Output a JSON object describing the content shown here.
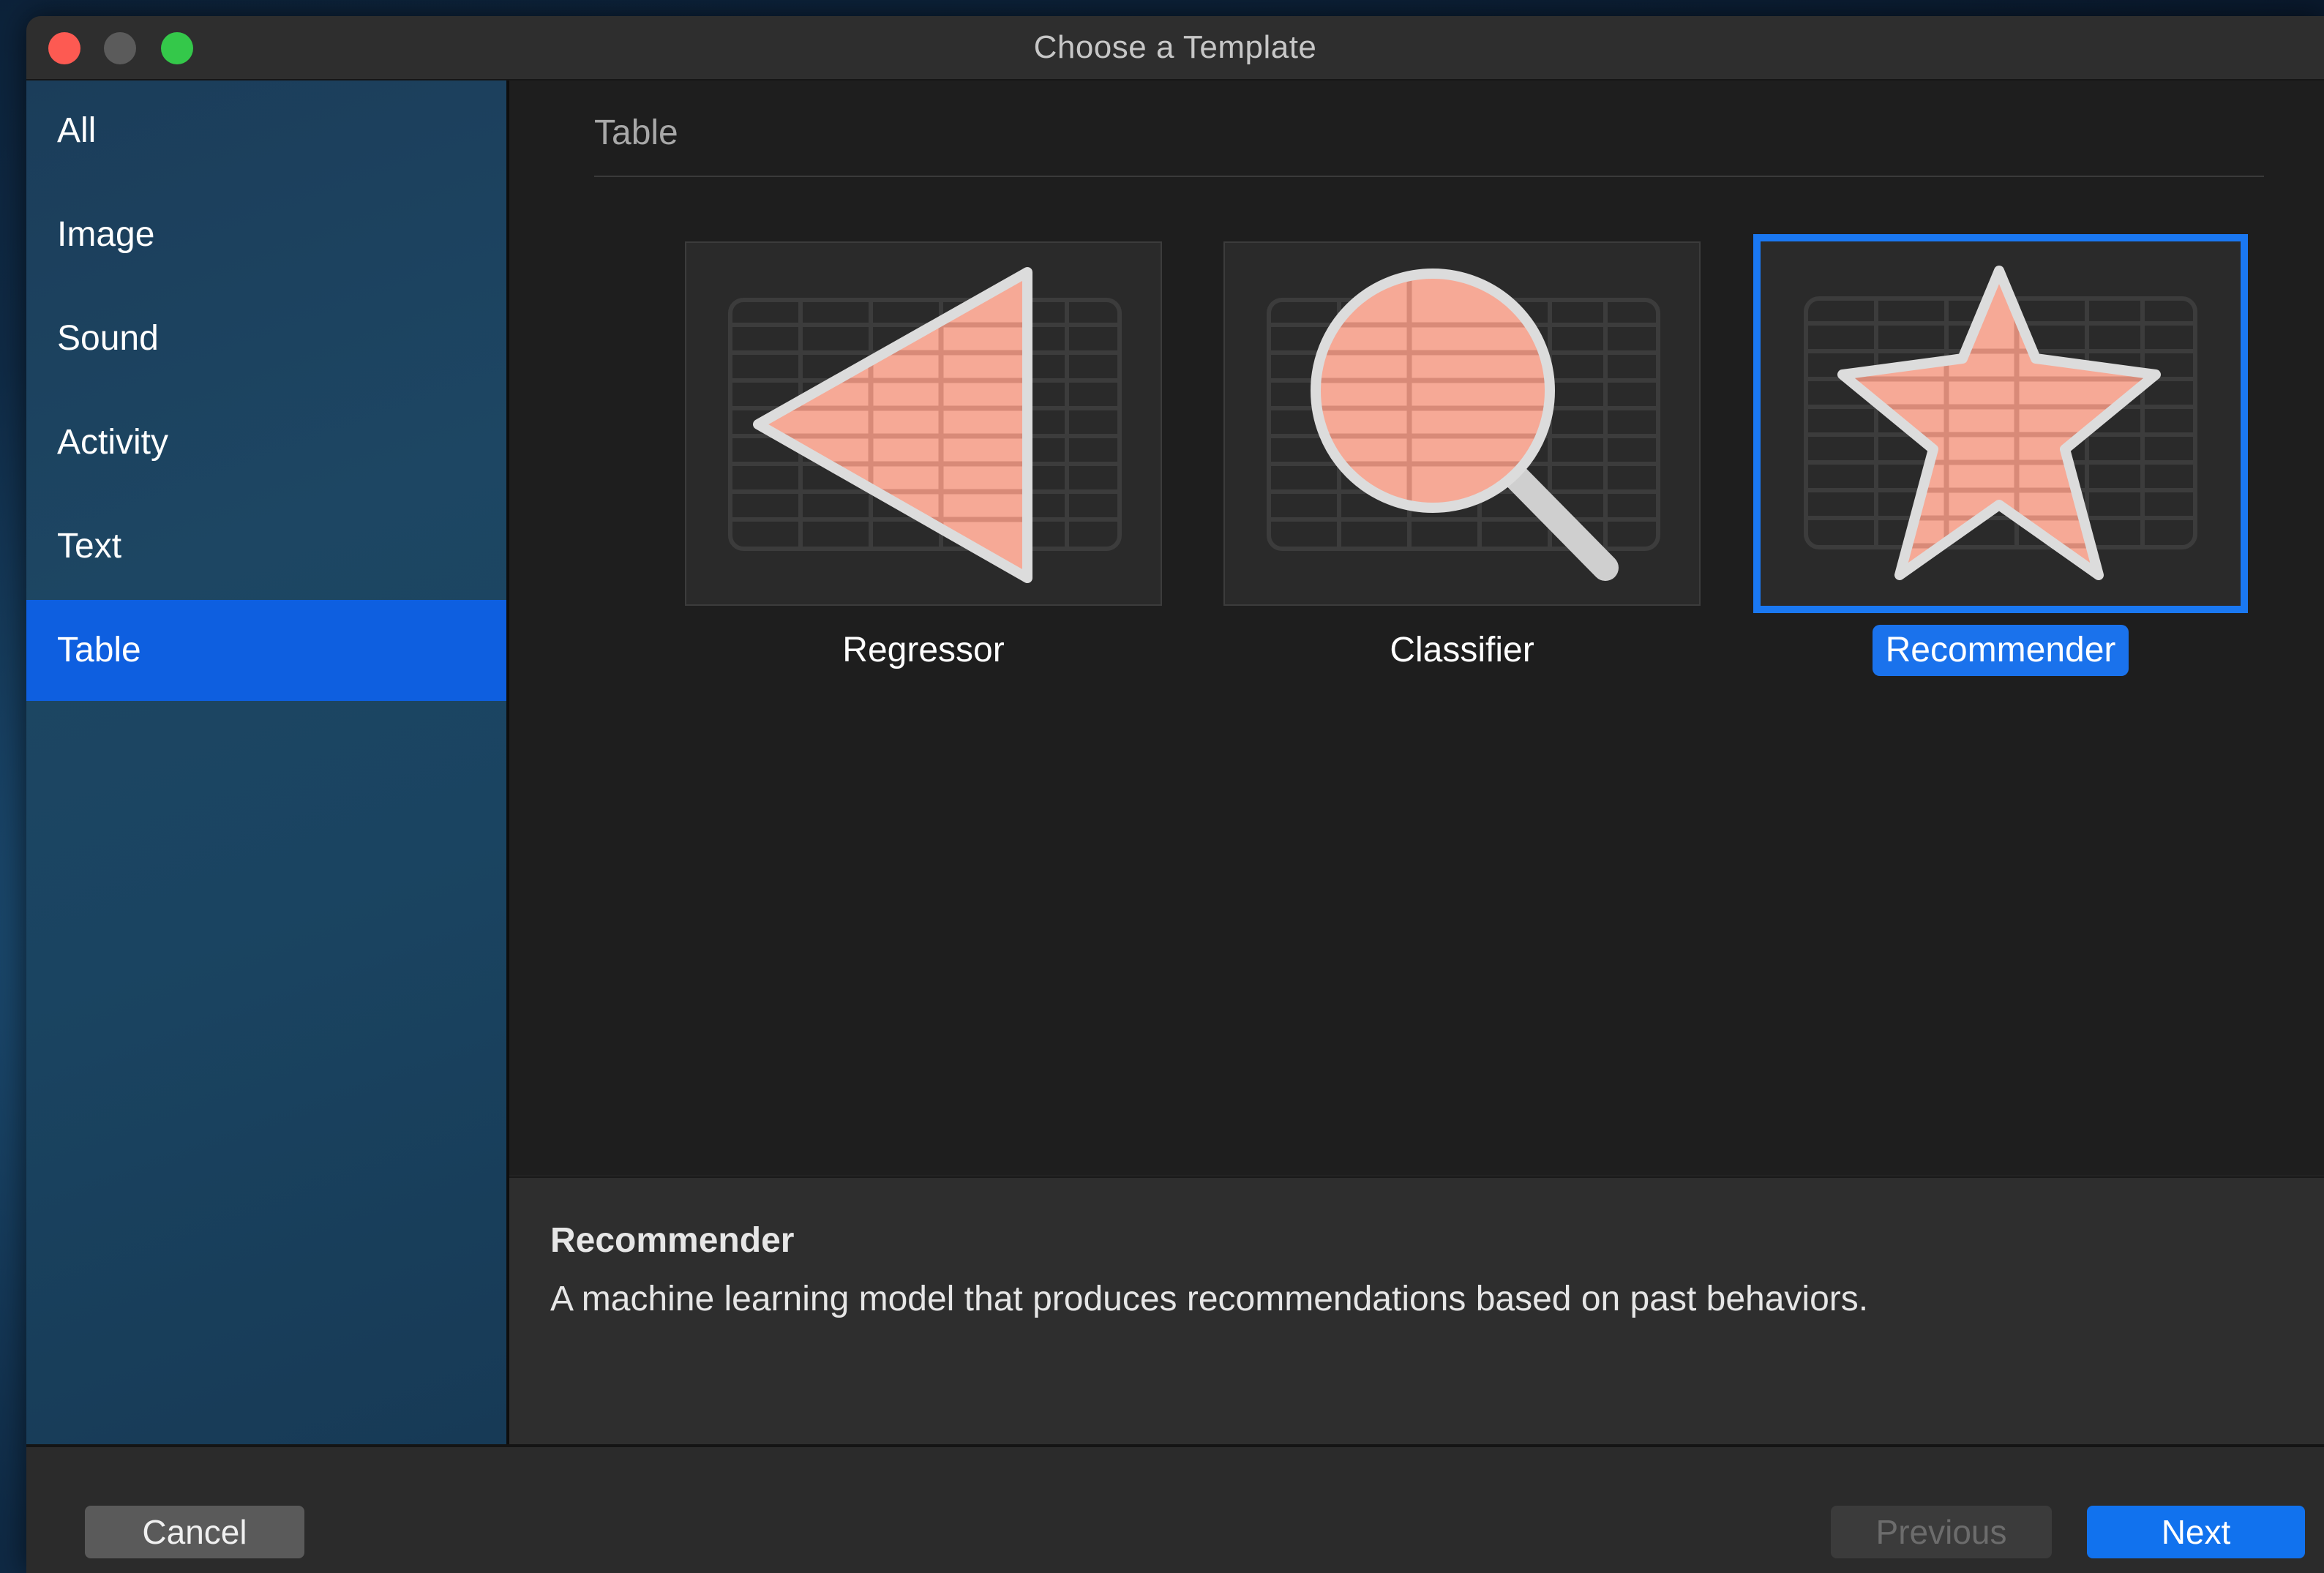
{
  "window": {
    "title": "Choose a Template"
  },
  "sidebar": {
    "items": [
      {
        "label": "All"
      },
      {
        "label": "Image"
      },
      {
        "label": "Sound"
      },
      {
        "label": "Activity"
      },
      {
        "label": "Text"
      },
      {
        "label": "Table",
        "selected": true
      }
    ]
  },
  "main": {
    "section_title": "Table",
    "templates": [
      {
        "label": "Regressor",
        "icon": "regressor-triangle-icon"
      },
      {
        "label": "Classifier",
        "icon": "classifier-magnifier-icon"
      },
      {
        "label": "Recommender",
        "icon": "recommender-star-icon",
        "selected": true
      }
    ]
  },
  "description": {
    "title": "Recommender",
    "text": "A machine learning model that produces recommendations based on past behaviors."
  },
  "footer": {
    "cancel_label": "Cancel",
    "previous_label": "Previous",
    "next_label": "Next"
  },
  "colors": {
    "accent": "#1172ee",
    "selection": "#0e5fe0",
    "icon_fill": "#f6a996",
    "icon_outline": "#d8d8d8"
  }
}
